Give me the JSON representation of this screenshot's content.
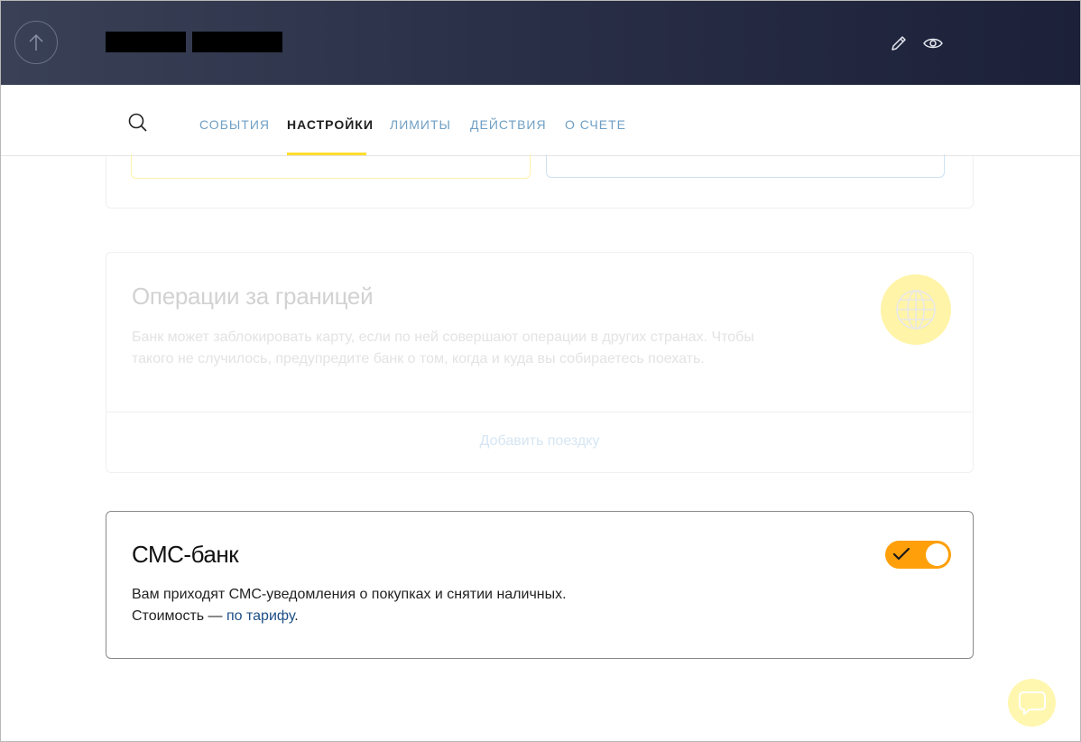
{
  "header": {
    "back_icon": "arrow-up-icon",
    "edit_icon": "pencil-icon",
    "view_icon": "eye-icon"
  },
  "tabs": {
    "search_icon": "search-icon",
    "items": [
      {
        "label": "События",
        "active": false
      },
      {
        "label": "Настройки",
        "active": true
      },
      {
        "label": "Лимиты",
        "active": false
      },
      {
        "label": "Действия",
        "active": false
      },
      {
        "label": "О счете",
        "active": false
      }
    ]
  },
  "abroad": {
    "title": "Операции за границей",
    "description": "Банк может заблокировать карту, если по ней совершают операции в других странах. Чтобы такого не случилось, предупредите банк о том, когда и куда вы собираетесь поехать.",
    "icon": "globe-icon",
    "add_trip_label": "Добавить поездку"
  },
  "sms": {
    "title": "СМС-банк",
    "line1": "Вам приходят СМС-уведомления о покупках и снятии наличных.",
    "cost_prefix": "Стоимость — ",
    "cost_link": "по тарифу",
    "cost_suffix": ".",
    "toggle_on": true
  },
  "chat": {
    "icon": "chat-bubble-icon"
  },
  "colors": {
    "accent": "#ffdd2d",
    "toggle": "#ff9f0a",
    "link": "#1e4f86",
    "tab": "#6f9fc4"
  }
}
